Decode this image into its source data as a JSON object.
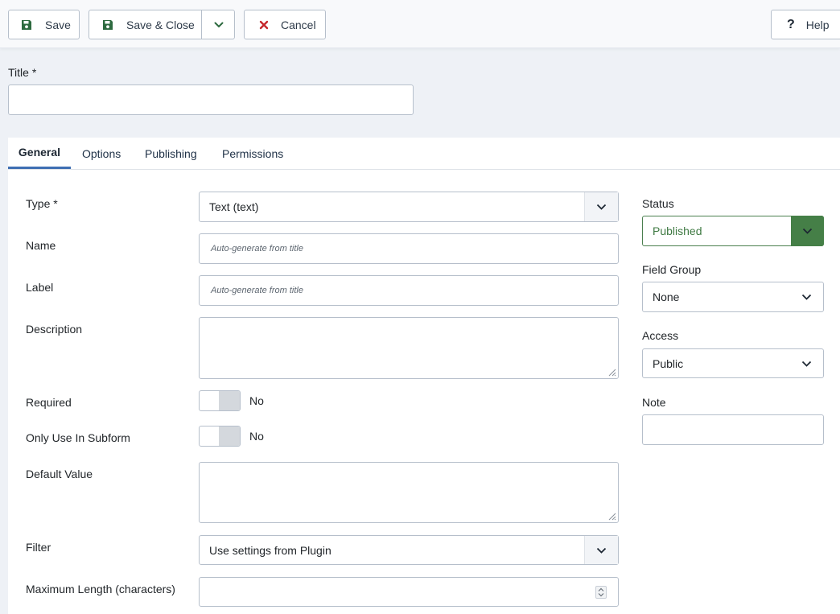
{
  "toolbar": {
    "save_label": "Save",
    "save_close_label": "Save & Close",
    "cancel_label": "Cancel",
    "help_label": "Help",
    "help_glyph": "?"
  },
  "title": {
    "label": "Title *",
    "value": ""
  },
  "tabs": [
    {
      "label": "General",
      "active": true
    },
    {
      "label": "Options",
      "active": false
    },
    {
      "label": "Publishing",
      "active": false
    },
    {
      "label": "Permissions",
      "active": false
    }
  ],
  "fields": {
    "type": {
      "label": "Type *",
      "value": "Text (text)"
    },
    "name": {
      "label": "Name",
      "placeholder": "Auto-generate from title"
    },
    "label": {
      "label": "Label",
      "placeholder": "Auto-generate from title"
    },
    "description": {
      "label": "Description",
      "value": ""
    },
    "required": {
      "label": "Required",
      "state": "No"
    },
    "only_subform": {
      "label": "Only Use In Subform",
      "state": "No"
    },
    "default_value": {
      "label": "Default Value",
      "value": ""
    },
    "filter": {
      "label": "Filter",
      "value": "Use settings from Plugin"
    },
    "max_length": {
      "label": "Maximum Length (characters)",
      "value": ""
    }
  },
  "sidebar": {
    "status": {
      "label": "Status",
      "value": "Published"
    },
    "field_group": {
      "label": "Field Group",
      "value": "None"
    },
    "access": {
      "label": "Access",
      "value": "Public"
    },
    "note": {
      "label": "Note",
      "value": ""
    }
  },
  "colors": {
    "save_icon": "#2d6a3f",
    "cancel_icon": "#c5262b",
    "active_tab": "#3f6fb3",
    "status_green": "#457f47"
  },
  "icons": {
    "save": "floppy-disk-icon",
    "save_close": "floppy-disk-icon",
    "dropdown": "chevron-down-icon",
    "cancel": "close-icon",
    "help": "question-icon"
  }
}
